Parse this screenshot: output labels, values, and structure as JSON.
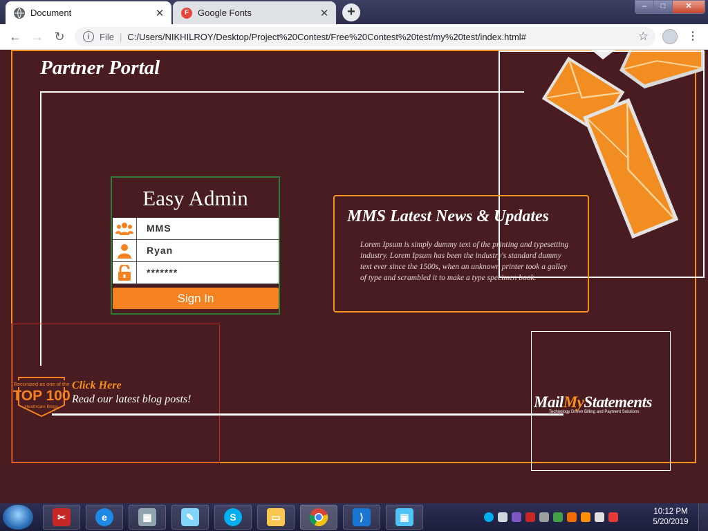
{
  "browser": {
    "tabs": [
      {
        "label": "Document",
        "favicon": "globe-icon",
        "active": true
      },
      {
        "label": "Google Fonts",
        "favicon": "google-fonts-icon",
        "favicon_letter": "F",
        "active": false
      }
    ],
    "new_tab_symbol": "+",
    "window_controls": {
      "minimize": "–",
      "maximize": "□",
      "close": "✕"
    },
    "nav": {
      "back": "←",
      "forward": "→",
      "reload": "↻"
    },
    "address": {
      "info_symbol": "i",
      "scheme_label": "File",
      "separator": "|",
      "url": "C:/Users/NIKHILROY/Desktop/Project%20Contest/Free%20Contest%20test/my%20test/index.html#"
    },
    "bookmark_symbol": "☆",
    "menu_symbol": "⋮"
  },
  "page": {
    "title": "Partner Portal",
    "login": {
      "heading": "Easy Admin",
      "fields": [
        {
          "icon": "users-icon",
          "value": "MMS"
        },
        {
          "icon": "user-icon",
          "value": "Ryan"
        },
        {
          "icon": "unlock-icon",
          "value": "*******"
        }
      ],
      "submit_label": "Sign In"
    },
    "news": {
      "heading": "MMS Latest News & Updates",
      "body": "Lorem Ipsum is simply dummy text of the printing and typesetting industry. Lorem Ipsum has been the industry's standard dummy text ever since the 1500s, when an unknown printer took a galley of type and scrambled it to make a type specimen book."
    },
    "blog": {
      "badge": {
        "line1": "Reconized as one of the",
        "line2": "TOP 100",
        "line3": "Heathcare Blogs"
      },
      "link_label": "Click Here",
      "text": "Read our latest blog posts!"
    },
    "logo": {
      "part1": "Mail",
      "part2": "My",
      "part3": "Statements",
      "tagline": "Technology Driven  Billing and Payment Solutions"
    },
    "colors": {
      "accent": "#f7911e",
      "page_bg": "#481c20",
      "login_border": "#2e7d32"
    }
  },
  "taskbar": {
    "apps": [
      "snipping-tool-icon",
      "internet-explorer-icon",
      "calculator-icon",
      "notepad-icon",
      "skype-icon",
      "file-explorer-icon",
      "chrome-icon",
      "visual-studio-code-icon",
      "photo-viewer-icon"
    ],
    "clock": {
      "time": "10:12 PM",
      "date": "5/20/2019"
    }
  }
}
